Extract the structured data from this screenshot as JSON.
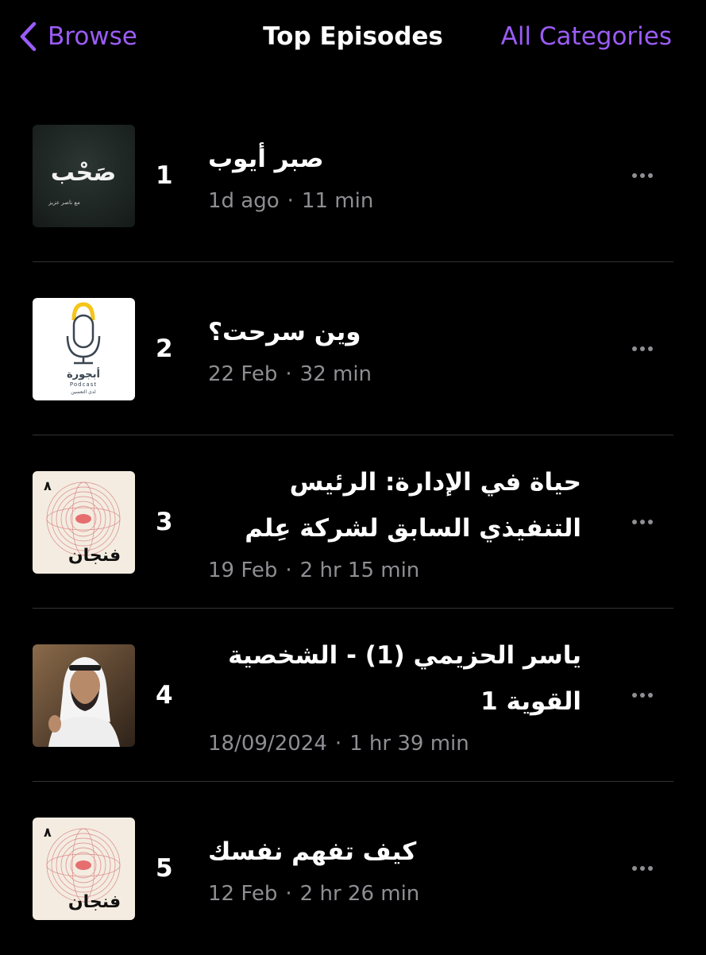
{
  "nav": {
    "back_label": "Browse",
    "title": "Top Episodes",
    "right_label": "All Categories"
  },
  "colors": {
    "accent": "#9b5cf6",
    "background": "#000000",
    "secondary_text": "#8e8e93",
    "divider": "#333333"
  },
  "episodes": [
    {
      "rank": "1",
      "title": "صبر أيوب",
      "date": "1d ago",
      "duration": "11 min",
      "artwork": {
        "icon": "sahb-podcast-artwork",
        "text": "صَحْب",
        "subtext": "مع ناصر عزيز"
      }
    },
    {
      "rank": "2",
      "title": "وين سرحت؟",
      "date": "22 Feb",
      "duration": "32 min",
      "artwork": {
        "icon": "abjora-podcast-artwork",
        "text": "أبجورة",
        "subtext": "Podcast",
        "caption": "لدى التعسين"
      }
    },
    {
      "rank": "3",
      "title": "حياة في الإدارة: الرئيس التنفيذي السابق لشركة عِلم",
      "date": "19 Feb",
      "duration": "2 hr 15 min",
      "artwork": {
        "icon": "finjan-podcast-artwork",
        "text": "فنجان",
        "badge": "٨"
      }
    },
    {
      "rank": "4",
      "title": "ياسر الحزيمي (1) - الشخصية القوية 1",
      "date": "18/09/2024",
      "duration": "1 hr 39 min",
      "artwork": {
        "icon": "speaker-photo-artwork"
      }
    },
    {
      "rank": "5",
      "title": "كيف تفهم نفسك",
      "date": "12 Feb",
      "duration": "2 hr 26 min",
      "artwork": {
        "icon": "finjan-podcast-artwork",
        "text": "فنجان",
        "badge": "٨"
      }
    }
  ],
  "dot_separator": "·"
}
